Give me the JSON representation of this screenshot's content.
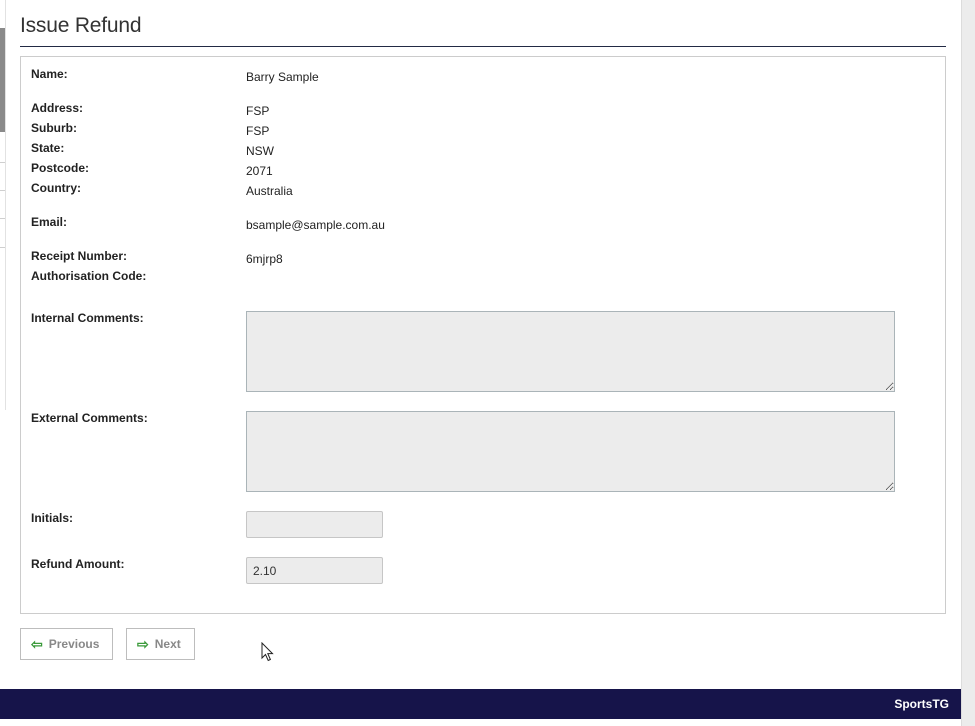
{
  "page": {
    "title": "Issue Refund"
  },
  "details": {
    "name_label": "Name:",
    "name_value": "Barry Sample",
    "address_label": "Address:",
    "address_value": "FSP",
    "suburb_label": "Suburb:",
    "suburb_value": "FSP",
    "state_label": "State:",
    "state_value": "NSW",
    "postcode_label": "Postcode:",
    "postcode_value": "2071",
    "country_label": "Country:",
    "country_value": "Australia",
    "email_label": "Email:",
    "email_value": "bsample@sample.com.au",
    "receipt_label": "Receipt Number:",
    "receipt_value": "6mjrp8",
    "auth_label": "Authorisation Code:",
    "auth_value": ""
  },
  "form": {
    "internal_comments_label": "Internal Comments:",
    "internal_comments_value": "",
    "external_comments_label": "External Comments:",
    "external_comments_value": "",
    "initials_label": "Initials:",
    "initials_value": "",
    "refund_amount_label": "Refund Amount:",
    "refund_amount_value": "2.10"
  },
  "nav": {
    "previous_label": "Previous",
    "next_label": "Next",
    "previous_icon": "arrow-left-icon",
    "next_icon": "arrow-right-icon"
  },
  "footer": {
    "brand": "SportsTG"
  },
  "colors": {
    "footer_bg": "#16144a",
    "accent_arrow": "#3a9a3a",
    "field_bg": "#ececec"
  }
}
